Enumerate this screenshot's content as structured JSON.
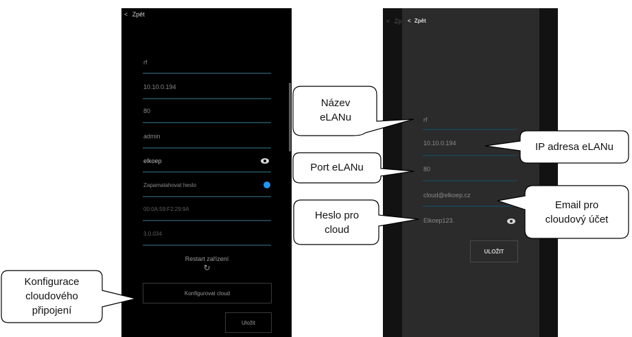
{
  "left_screen": {
    "back_label": "Zpět",
    "fields": [
      "rf",
      "10.10.0.194",
      "80",
      "admin",
      "elkoep"
    ],
    "remember_label": "Zapamatahovat heslo",
    "mac": "00:0A:59:F2:29:9A",
    "version": "3.0.034",
    "restart_label": "Restart zařízení",
    "configure_cloud_label": "Konfigurovat cloud",
    "save_label": "Uložit"
  },
  "right_screen": {
    "back_label": "Zpět",
    "bg_back_label": "Zp",
    "fields": [
      "rf",
      "10.10.0.194",
      "80",
      "cloud@elkoep.cz",
      "Elkoep123."
    ],
    "save_label": "ULOŽIT"
  },
  "callouts": {
    "name": [
      "Název",
      "eLANu"
    ],
    "port": "Port eLANu",
    "heslo": [
      "Heslo pro",
      "cloud"
    ],
    "config": [
      "Konfigurace",
      "cloudového",
      "připojení"
    ],
    "ip": "IP adresa eLANu",
    "email": [
      "Email pro",
      "cloudový účet"
    ]
  },
  "colors": {
    "accent": "#2196f3",
    "line": "#1e3f4d",
    "screen_bg": "#000000",
    "dialog_bg": "#2b2b2b"
  }
}
